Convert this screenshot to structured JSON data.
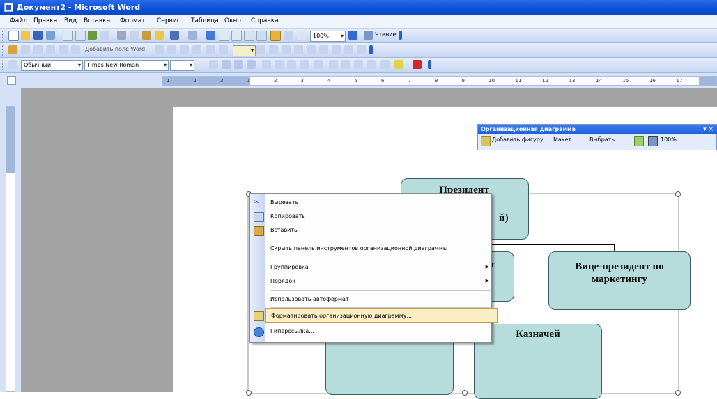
{
  "window": {
    "title": "Документ2 - Microsoft Word"
  },
  "menu": [
    "Файл",
    "Правка",
    "Вид",
    "Вставка",
    "Формат",
    "Сервис",
    "Таблица",
    "Окно",
    "Справка"
  ],
  "toolbar1": {
    "zoom": "100%",
    "read_label": "Чтение"
  },
  "toolbar2": {
    "label": "Добавить поле Word"
  },
  "toolbar3": {
    "style": "Обычный",
    "font": "Times New Roman"
  },
  "ruler": {
    "marks": [
      "1",
      "2",
      "3",
      "1",
      "2",
      "3",
      "4",
      "5",
      "6",
      "7",
      "8",
      "9",
      "10",
      "11",
      "12",
      "13",
      "14",
      "15",
      "16",
      "17"
    ]
  },
  "org_toolbar": {
    "title": "Организационная диаграмма",
    "add_shape": "Добавить фигуру",
    "layout": "Макет",
    "select": "Выбрать",
    "zoom": "100%",
    "close": "▾ ×"
  },
  "chart": {
    "president_line1": "Президент",
    "president_line2_fragment": "й)",
    "vp_left_fragment1": "ент",
    "vp_left_fragment2": "м",
    "vp_marketing": "Вице-президент по маркетингу",
    "treasurer": "Казначей"
  },
  "context_menu": {
    "items": [
      {
        "label": "Вырезать",
        "icon": "cut-icon"
      },
      {
        "label": "Копировать",
        "icon": "copy-icon"
      },
      {
        "label": "Вставить",
        "icon": "paste-icon"
      },
      {
        "label": "Скрыть панель инструментов организационной диаграммы",
        "icon": ""
      },
      {
        "label": "Группировка",
        "icon": "",
        "submenu": true
      },
      {
        "label": "Порядок",
        "icon": "",
        "submenu": true
      },
      {
        "label": "Использовать автоформат",
        "icon": ""
      },
      {
        "label": "Форматировать организационную диаграмму...",
        "icon": "format-icon",
        "selected": true
      },
      {
        "label": "Гиперссылка...",
        "icon": "hyperlink-icon"
      }
    ]
  },
  "colors": {
    "titlebar": "#0a4fd6",
    "box_fill": "#b7dcdc",
    "highlight": "#fbeec5"
  }
}
